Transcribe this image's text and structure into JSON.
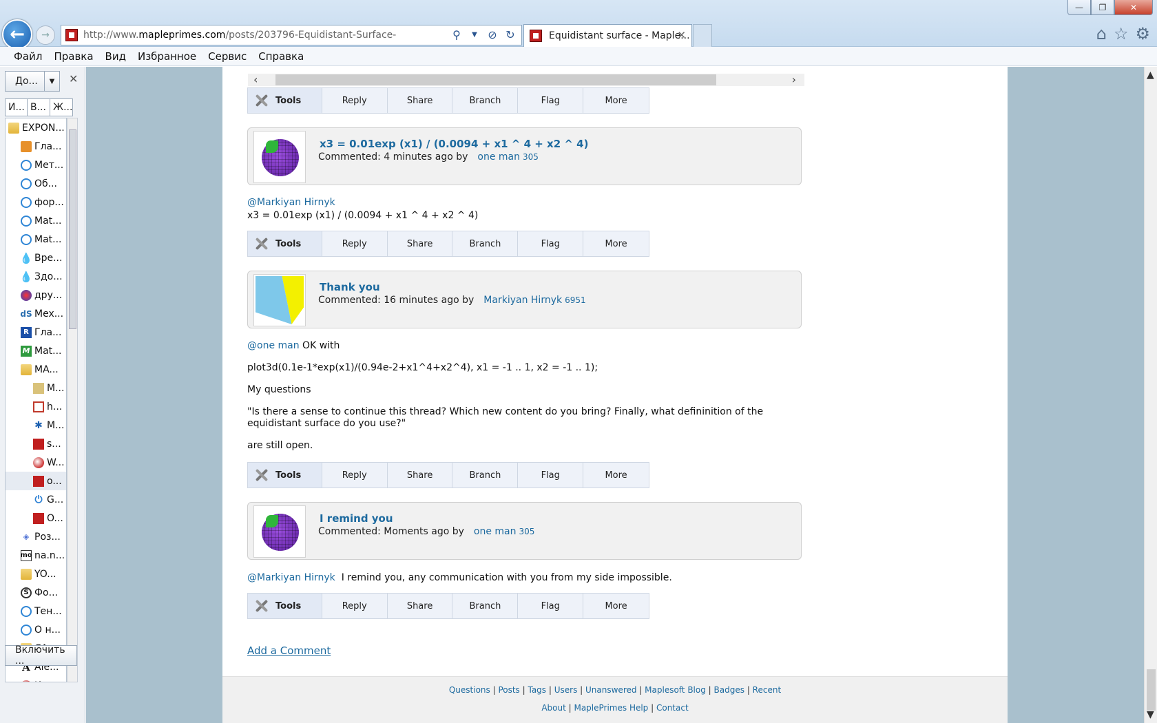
{
  "browser": {
    "url_prefix": "http://www.",
    "url_domain": "mapleprimes.com",
    "url_path": "/posts/203796-Equidistant-Surface-",
    "tab_title": "Equidistant surface - Maple...",
    "tab_close": "✕",
    "back_glyph": "←",
    "fwd_glyph": "→",
    "win_min": "—",
    "win_max": "❐",
    "win_close": "✕",
    "icons": [
      "search-icon",
      "dropdown-icon",
      "stop-icon",
      "refresh-icon",
      "home-icon",
      "favorites-star-icon",
      "settings-gear-icon"
    ]
  },
  "menu": [
    "Файл",
    "Правка",
    "Вид",
    "Избранное",
    "Сервис",
    "Справка"
  ],
  "sidebar": {
    "top_button": "До...",
    "close": "✕",
    "tabs": [
      "И...",
      "В...",
      "Ж..."
    ],
    "items": [
      {
        "label": "EXPON...",
        "icon": "folder",
        "indent": 0
      },
      {
        "label": "Гла...",
        "icon": "orange",
        "indent": 1
      },
      {
        "label": "Мет...",
        "icon": "ie",
        "indent": 1
      },
      {
        "label": "Об...",
        "icon": "ie",
        "indent": 1
      },
      {
        "label": "фор...",
        "icon": "ie",
        "indent": 1
      },
      {
        "label": "Mat...",
        "icon": "ie",
        "indent": 1
      },
      {
        "label": "Mat...",
        "icon": "ie",
        "indent": 1
      },
      {
        "label": "Вре...",
        "icon": "drop",
        "indent": 1
      },
      {
        "label": "Здо...",
        "icon": "drop",
        "indent": 1
      },
      {
        "label": "дру...",
        "icon": "multi",
        "indent": 1
      },
      {
        "label": "Mex...",
        "icon": "ds",
        "indent": 1
      },
      {
        "label": "Гла...",
        "icon": "r",
        "indent": 1
      },
      {
        "label": "Mat...",
        "icon": "m",
        "indent": 1
      },
      {
        "label": "MA...",
        "icon": "folder",
        "indent": 1
      },
      {
        "label": "M...",
        "icon": "cube",
        "indent": 2
      },
      {
        "label": "h...",
        "icon": "redsq",
        "indent": 2
      },
      {
        "label": "M...",
        "icon": "maple",
        "indent": 2
      },
      {
        "label": "s...",
        "icon": "mred",
        "indent": 2
      },
      {
        "label": "W...",
        "icon": "w",
        "indent": 2
      },
      {
        "label": "o...",
        "icon": "mred",
        "indent": 2,
        "selected": true
      },
      {
        "label": "G...",
        "icon": "power",
        "indent": 2
      },
      {
        "label": "O...",
        "icon": "mred",
        "indent": 2
      },
      {
        "label": "Роз...",
        "icon": "gem",
        "indent": 1
      },
      {
        "label": "na.n...",
        "icon": "mo",
        "indent": 1
      },
      {
        "label": "YO...",
        "icon": "folder",
        "indent": 1
      },
      {
        "label": "Фо...",
        "icon": "s",
        "indent": 1
      },
      {
        "label": "Тен...",
        "icon": "ie",
        "indent": 1
      },
      {
        "label": "О н...",
        "icon": "ie",
        "indent": 1
      },
      {
        "label": "CA...",
        "icon": "folder",
        "indent": 1
      },
      {
        "label": "Ale...",
        "icon": "A",
        "indent": 1
      },
      {
        "label": "Иси...",
        "icon": "w",
        "indent": 1
      }
    ],
    "bottom_button": "Включить ..."
  },
  "toolbar": {
    "tools": "Tools",
    "reply": "Reply",
    "share": "Share",
    "branch": "Branch",
    "flag": "Flag",
    "more": "More"
  },
  "comments": [
    {
      "title": "x3 = 0.01exp (x1) / (0.0094 + x1 ^ 4 + x2 ^ 4)",
      "meta": "Commented: 4 minutes ago by",
      "user": "one man",
      "rep": "305",
      "avatar": "purple-globe"
    },
    {
      "title": "Thank you",
      "meta": "Commented: 16 minutes ago by",
      "user": "Markiyan Hirnyk",
      "rep": "6951",
      "avatar": "blue-yellow"
    },
    {
      "title": "I remind you",
      "meta": "Commented: Moments ago by",
      "user": "one man",
      "rep": "305",
      "avatar": "purple-globe"
    }
  ],
  "bodies": {
    "b1_mention": "@Markiyan Hirnyk",
    "b1_text": "x3 = 0.01exp (x1) / (0.0094 + x1 ^ 4 + x2 ^ 4)",
    "b2_mention": "@one man",
    "b2_text1": " OK with",
    "b2_text2": "plot3d(0.1e-1*exp(x1)/(0.94e-2+x1^4+x2^4), x1 = -1 .. 1, x2 = -1 .. 1);",
    "b2_text3": "My questions",
    "b2_text4": "\"Is there a sense to continue this thread? Which new content do you bring? Finally, what defininition of the",
    "b2_text5": "equidistant surface do you use?\"",
    "b2_text6": "are still open.",
    "b3_mention": "@Markiyan Hirnyk",
    "b3_text": "  I remind you, any communication with you from my side impossible."
  },
  "add_comment": "Add a Comment",
  "footer": {
    "row1": [
      "Questions",
      "Posts",
      "Tags",
      "Users",
      "Unanswered",
      "Maplesoft Blog",
      "Badges",
      "Recent"
    ],
    "row2": [
      "About",
      "MaplePrimes Help",
      "Contact"
    ]
  }
}
